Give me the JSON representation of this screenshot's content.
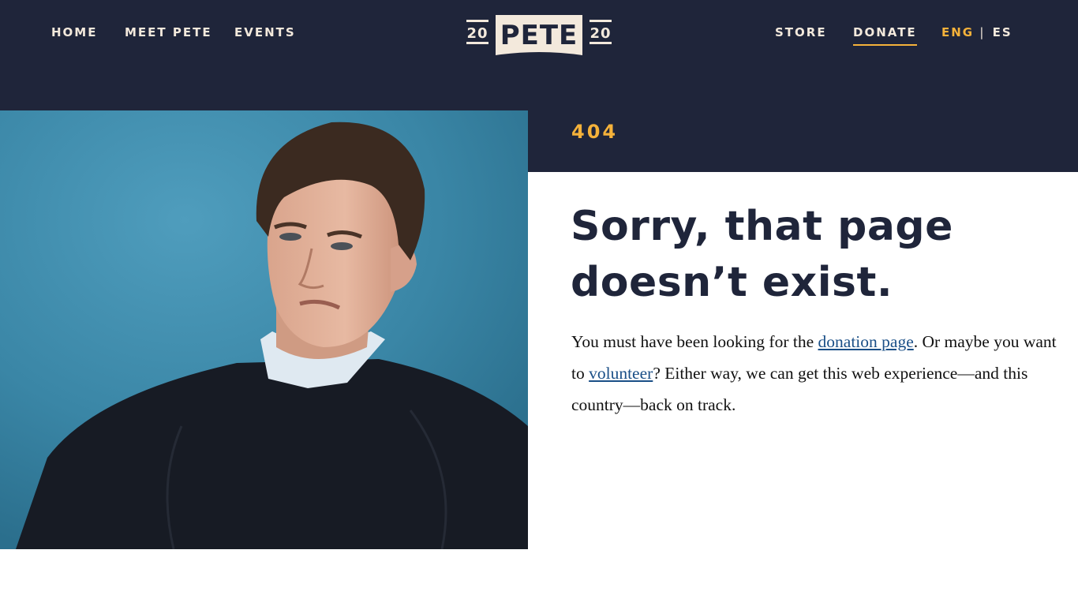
{
  "nav": {
    "home": "HOME",
    "meet": "MEET PETE",
    "events": "EVENTS",
    "store": "STORE",
    "donate": "DONATE",
    "lang_eng": "ENG",
    "lang_sep": "|",
    "lang_es": "ES"
  },
  "logo": {
    "year_left": "20",
    "name": "PETE",
    "year_right": "20"
  },
  "error": {
    "code": "404",
    "headline_line1": "Sorry, that page",
    "headline_line2": "doesn’t exist.",
    "body_part1": "You must have been looking for the ",
    "link_donation": "donation page",
    "body_part2": ". Or maybe you want to ",
    "link_volunteer": "volunteer",
    "body_part3": "? Either way, we can get this web experience—and this country—back on track."
  },
  "colors": {
    "navy": "#1f253a",
    "gold": "#f5b23a",
    "cream": "#f3e9dc",
    "link": "#1a4f87",
    "photo_bg": "#3f8bab"
  },
  "icons": {
    "logo": "pete-2020-logo"
  }
}
